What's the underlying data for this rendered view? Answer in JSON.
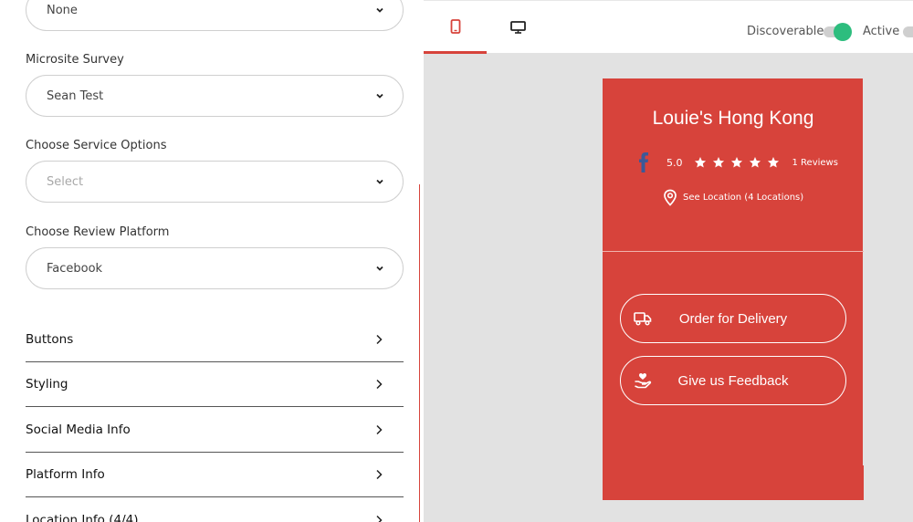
{
  "form": {
    "top_select": {
      "value": "None"
    },
    "survey": {
      "label": "Microsite Survey",
      "value": "Sean Test"
    },
    "service": {
      "label": "Choose Service Options",
      "placeholder": "Select"
    },
    "review_platform": {
      "label": "Choose Review Platform",
      "value": "Facebook"
    }
  },
  "sections": [
    "Buttons",
    "Styling",
    "Social Media Info",
    "Platform Info",
    "Location Info (4/4)"
  ],
  "topbar": {
    "discoverable_label": "Discoverable",
    "active_label": "Active",
    "discoverable_on": true,
    "active_on": false
  },
  "preview": {
    "business_name": "Louie's Hong Kong",
    "rating": "5.0",
    "stars": 5,
    "reviews": "1 Reviews",
    "location": "See Location (4 Locations)",
    "buttons": [
      "Order for Delivery",
      "Give us Feedback"
    ]
  },
  "colors": {
    "brand": "#d7433b",
    "toggle_on": "#2dbd7e",
    "facebook": "#3b5998"
  }
}
